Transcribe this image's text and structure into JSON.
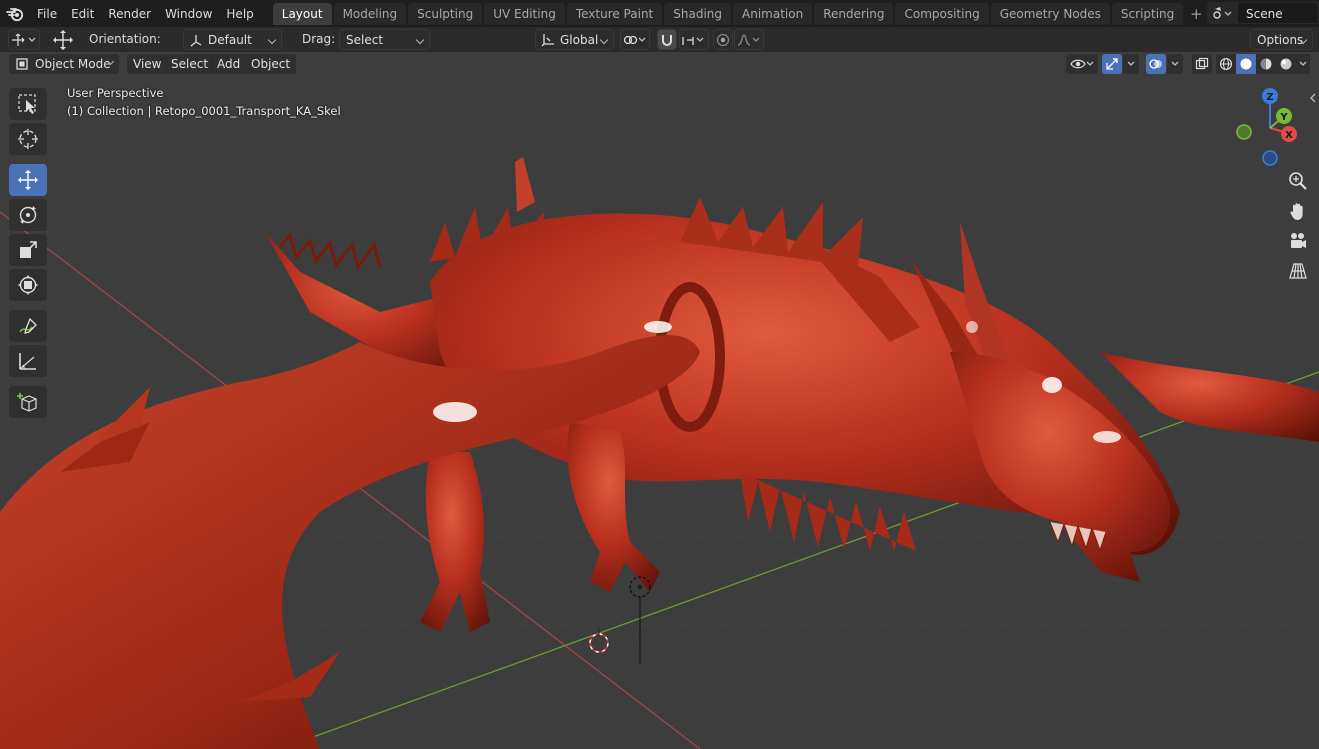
{
  "topbar": {
    "menus": [
      "File",
      "Edit",
      "Render",
      "Window",
      "Help"
    ],
    "workspaces": [
      {
        "label": "Layout",
        "active": true
      },
      {
        "label": "Modeling",
        "active": false
      },
      {
        "label": "Sculpting",
        "active": false
      },
      {
        "label": "UV Editing",
        "active": false
      },
      {
        "label": "Texture Paint",
        "active": false
      },
      {
        "label": "Shading",
        "active": false
      },
      {
        "label": "Animation",
        "active": false
      },
      {
        "label": "Rendering",
        "active": false
      },
      {
        "label": "Compositing",
        "active": false
      },
      {
        "label": "Geometry Nodes",
        "active": false
      },
      {
        "label": "Scripting",
        "active": false
      }
    ],
    "add_workspace": "+",
    "scene_label": "Scene"
  },
  "toolsettings": {
    "orientation_label": "Orientation:",
    "orientation_value": "Default",
    "drag_label": "Drag:",
    "drag_value": "Select Box",
    "transform_space": "Global",
    "options_label": "Options"
  },
  "viewport_header": {
    "mode": "Object Mode",
    "view": "View",
    "select": "Select",
    "add": "Add",
    "object": "Object"
  },
  "viewport": {
    "perspective": "User Perspective",
    "collection": "(1) Collection | Retopo_0001_Transport_KA_Skel",
    "gizmo_axes": {
      "x": "X",
      "y": "Y",
      "z": "Z"
    }
  },
  "toolbar": {
    "tools": [
      "select-box",
      "cursor",
      "move",
      "rotate",
      "scale",
      "transform",
      "annotate",
      "measure",
      "add-cube"
    ],
    "active_tool": "move"
  },
  "colors": {
    "accent": "#4b72b7",
    "dragon": "#b8301e",
    "x_axis": "#e34b4b",
    "y_axis": "#7cb93b",
    "z_axis": "#3a7be0"
  }
}
